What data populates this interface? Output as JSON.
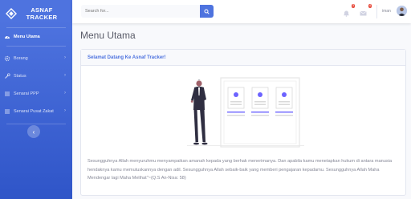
{
  "brand": {
    "title": "ASNAF TRACKER"
  },
  "sidebar": {
    "items": [
      {
        "label": "Menu Utama",
        "icon": "dashboard-icon",
        "active": true
      },
      {
        "label": "Borang",
        "icon": "cog-icon"
      },
      {
        "label": "Status",
        "icon": "wrench-icon"
      },
      {
        "label": "Senarai PPP",
        "icon": "list-icon"
      },
      {
        "label": "Senarai Pusat Zakat",
        "icon": "list-icon"
      }
    ]
  },
  "topbar": {
    "search_placeholder": "Search for...",
    "alerts_count": "3",
    "messages_count": "4",
    "username": "iman"
  },
  "main": {
    "title": "Menu Utama",
    "card_header": "Selamat Datang Ke Asnaf Tracker!",
    "card_text": "Sesungguhnya Allah menyuruhmu menyampaikan amanah kepada yang berhak menerimanya. Dan apabila kamu menetapkan hukum di antara manusia hendaknya kamu memutuskannya dengan adil. Sesungguhnya Allah sebaik-baik yang memberi pengajaran kepadamu. Sesungguhnya Allah Maha Mendengar lagi Maha Melihat\"~(Q.S An-Nisa: 58)"
  },
  "colors": {
    "primary": "#4e73df",
    "danger": "#e74a3b",
    "illus_accent": "#6c63ff"
  }
}
